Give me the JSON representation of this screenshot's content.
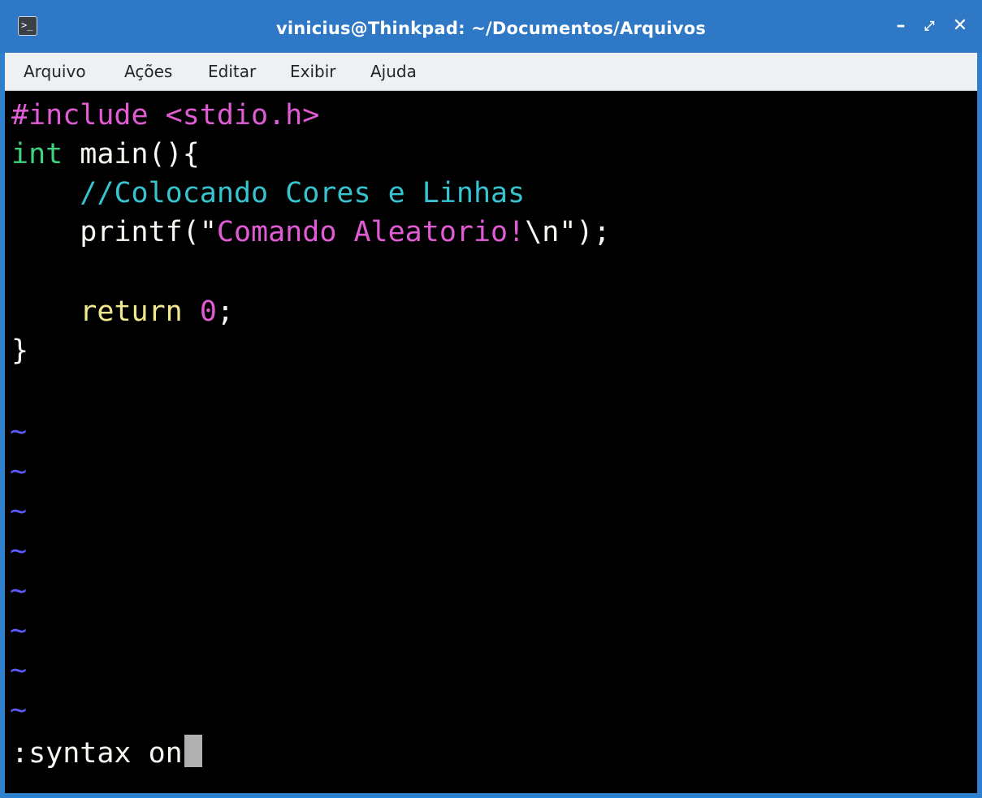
{
  "window": {
    "title": "vinicius@Thinkpad: ~/Documentos/Arquivos",
    "controls": {
      "minimize": "–",
      "maximize": "⤢",
      "close": "✕"
    },
    "icon": "terminal-icon",
    "icon_glyph": ">_"
  },
  "menubar": {
    "items": [
      "Arquivo",
      "Ações",
      "Editar",
      "Exibir",
      "Ajuda"
    ]
  },
  "editor": {
    "lines": {
      "l1": {
        "directive": "#include ",
        "header": "<stdio.h>"
      },
      "l2": {
        "type": "int",
        "rest": " main(){"
      },
      "l3": {
        "comment": "//Colocando Cores e Linhas"
      },
      "l4": {
        "fn": "printf(",
        "q1": "\"",
        "str": "Comando Aleatorio!",
        "esc": "\\n",
        "q2": "\"",
        "end": ");"
      },
      "l6": {
        "kw": "return",
        "space": " ",
        "num": "0",
        "semi": ";"
      },
      "l7": {
        "brace": "}"
      }
    },
    "empty_line_marker": "~",
    "empty_line_count": 8,
    "command_line": ":syntax on"
  },
  "colors": {
    "titlebar": "#2e78c6",
    "window_border": "#2f7fcf",
    "menubar_bg": "#eff0f1",
    "terminal_bg": "#000000",
    "preproc": "#e05bd4",
    "include_path": "#e05bd4",
    "type": "#3fd27c",
    "comment": "#37c3cf",
    "string": "#e05bd4",
    "keyword": "#f0e88c",
    "number": "#e05bd4",
    "default_text": "#f8f8f2",
    "tilde": "#5b5bff",
    "cursor": "#b0b0b0",
    "menu_text": "#232629"
  }
}
